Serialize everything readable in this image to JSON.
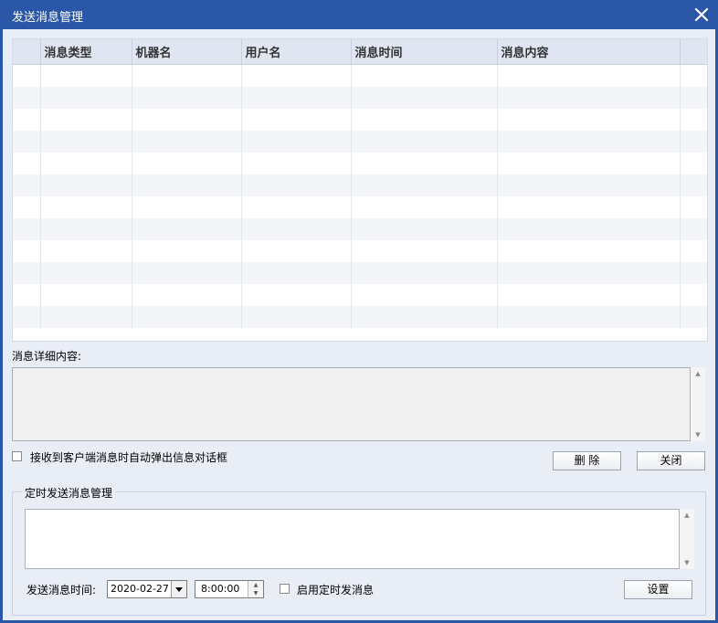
{
  "window": {
    "title": "发送消息管理"
  },
  "grid": {
    "columns": [
      "",
      "消息类型",
      "机器名",
      "用户名",
      "消息时间",
      "消息内容",
      ""
    ],
    "row_count": 12
  },
  "detail": {
    "label": "消息详细内容:"
  },
  "popup_checkbox": {
    "label": "接收到客户端消息时自动弹出信息对话框",
    "checked": false
  },
  "buttons": {
    "delete": "删 除",
    "close": "关闭",
    "set": "设置"
  },
  "schedule": {
    "group_title": "定时发送消息管理",
    "time_label": "发送消息时间:",
    "date_value": "2020-02-27",
    "time_value": "8:00:00",
    "enable_label": "启用定时发消息",
    "enable_checked": false
  },
  "icons": {
    "close": "close-icon",
    "dropdown": "chevron-down-icon",
    "spin": "spin-icon"
  },
  "colors": {
    "titlebar": "#2b57a9",
    "client": "#e9edf6"
  }
}
